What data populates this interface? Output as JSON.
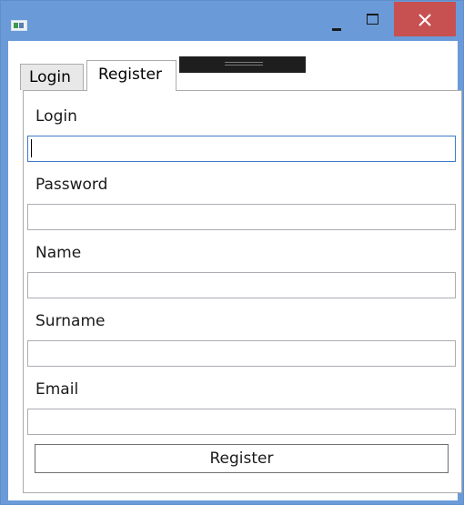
{
  "window": {
    "icon": "app-window-icon",
    "controls": {
      "minimize": "minimize-icon",
      "maximize": "maximize-icon",
      "close": "close-icon"
    },
    "colors": {
      "titlebar": "#6a9bd8",
      "close": "#c75050"
    }
  },
  "tabs": [
    {
      "label": "Login",
      "selected": false
    },
    {
      "label": "Register",
      "selected": true
    }
  ],
  "form": {
    "login": {
      "label": "Login",
      "value": ""
    },
    "password": {
      "label": "Password",
      "value": ""
    },
    "name": {
      "label": "Name",
      "value": ""
    },
    "surname": {
      "label": "Surname",
      "value": ""
    },
    "email": {
      "label": "Email",
      "value": ""
    },
    "submit_label": "Register"
  }
}
